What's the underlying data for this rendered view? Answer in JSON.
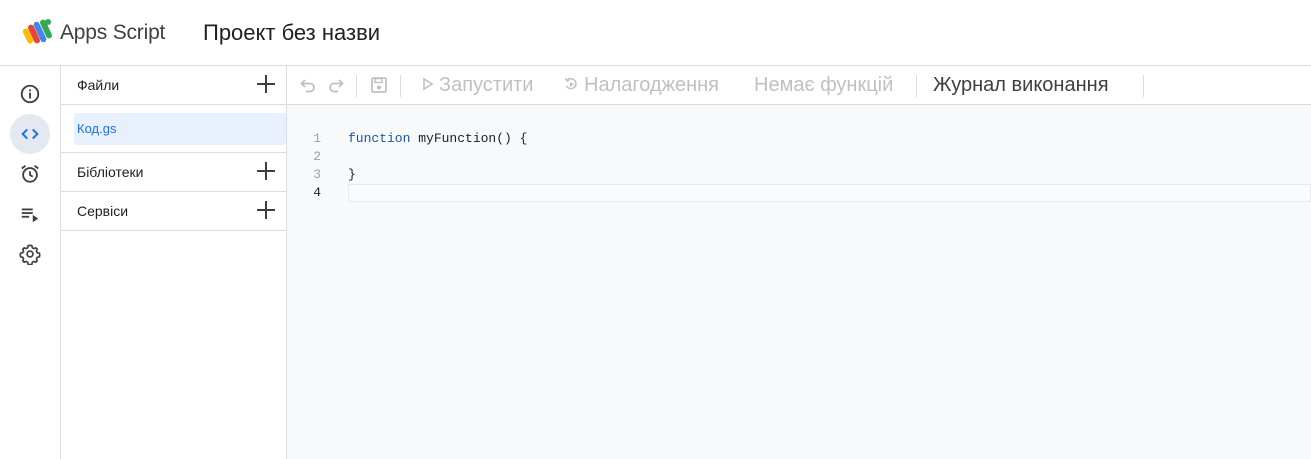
{
  "header": {
    "app_name": "Apps Script",
    "project_title": "Проект без назви"
  },
  "rail": {
    "items": [
      {
        "icon": "info-icon",
        "active": false
      },
      {
        "icon": "code-icon",
        "active": true
      },
      {
        "icon": "alarm-clock-icon",
        "active": false
      },
      {
        "icon": "playlist-play-icon",
        "active": false
      },
      {
        "icon": "gear-icon",
        "active": false
      }
    ]
  },
  "files_panel": {
    "files_label": "Файли",
    "files": [
      {
        "name": "Код.gs",
        "selected": true
      }
    ],
    "libraries_label": "Бібліотеки",
    "services_label": "Сервіси"
  },
  "toolbar": {
    "run_label": "Запустити",
    "debug_label": "Налагодження",
    "function_select_label": "Немає функцій",
    "execution_log_label": "Журнал виконання"
  },
  "editor": {
    "lines": [
      {
        "number": "1",
        "keyword": "function",
        "text": " myFunction() {"
      },
      {
        "number": "2",
        "keyword": "",
        "text": ""
      },
      {
        "number": "3",
        "keyword": "",
        "text": "}"
      },
      {
        "number": "4",
        "keyword": "",
        "text": ""
      }
    ],
    "current_line": "4"
  },
  "colors": {
    "accent": "#1a73e8",
    "selected_file_bg": "#e8f0fe",
    "disabled_text": "#bdc1c6",
    "border": "#dadce0",
    "editor_bg": "#f8f9fa"
  }
}
